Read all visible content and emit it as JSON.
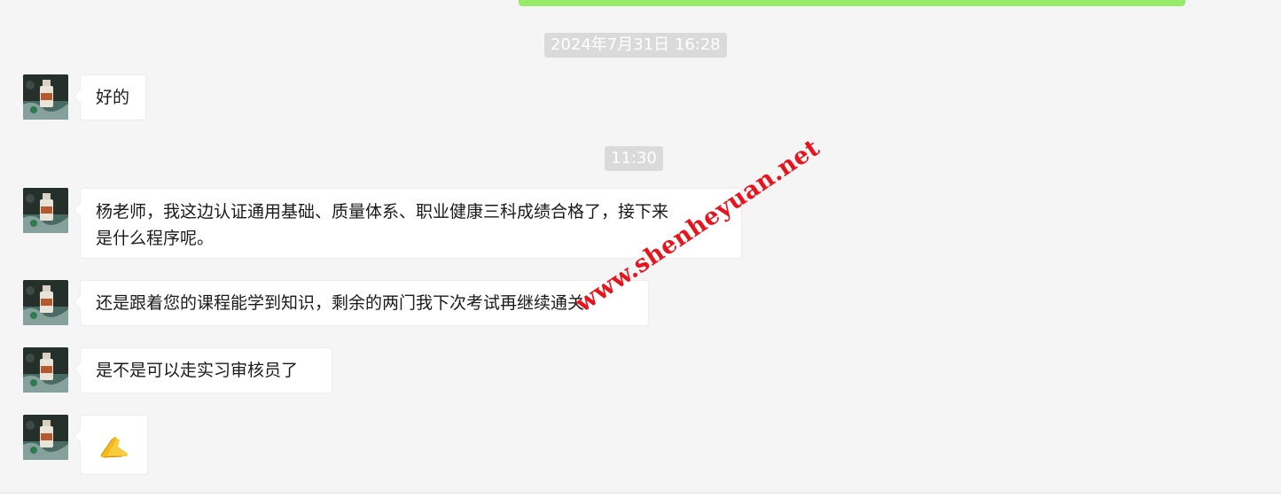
{
  "timestamps": [
    "2024年7月31日 16:28",
    "11:30"
  ],
  "messages": [
    {
      "text": "好的"
    },
    {
      "text": "杨老师，我这边认证通用基础、质量体系、职业健康三科成绩合格了，接下来",
      "text2": "是什么程序呢。"
    },
    {
      "text": "还是跟着您的课程能学到知识，剩余的两门我下次考试再继续通关"
    },
    {
      "text": "是不是可以走实习审核员了"
    },
    {
      "emoji": "folded-hands-emoji"
    }
  ],
  "watermark": "www.shenheyuan.net",
  "colors": {
    "background": "#f5f5f5",
    "self_bubble": "#95ec69",
    "other_bubble": "#ffffff",
    "timestamp_bg": "#dadada",
    "watermark": "#e8141c"
  }
}
